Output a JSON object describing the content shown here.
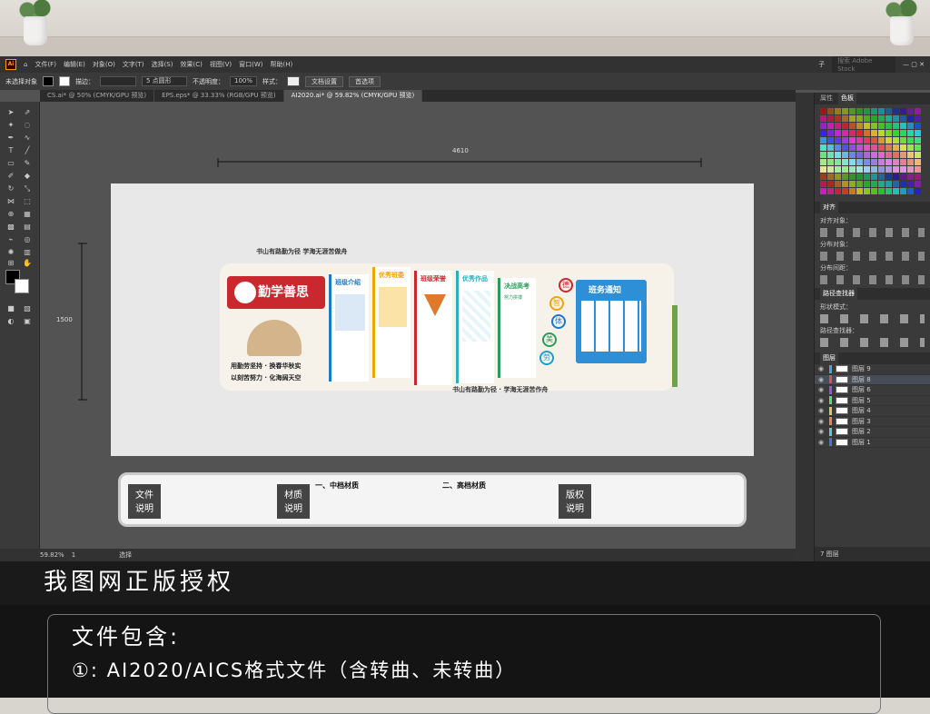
{
  "app": {
    "logo": "Ai",
    "menus": [
      "文件(F)",
      "编辑(E)",
      "对象(O)",
      "文字(T)",
      "选择(S)",
      "效果(C)",
      "视图(V)",
      "窗口(W)",
      "帮助(H)"
    ],
    "search_placeholder": "搜索 Adobe Stock",
    "user": "子"
  },
  "control": {
    "selection": "未选择对象",
    "stroke_label": "描边：",
    "point_type": "5 点圆形",
    "opacity_label": "不透明度：",
    "opacity": "100%",
    "style_label": "样式：",
    "doc_setup": "文档设置",
    "prefs": "首选项"
  },
  "tabs": [
    "CS.ai* @ 50% (CMYK/GPU 预览)",
    "EPS.eps* @ 33.33% (RGB/GPU 预览)",
    "AI2020.ai* @ 59.82% (CMYK/GPU 预览)"
  ],
  "canvas": {
    "width_dim": "4610",
    "height_dim": "1500"
  },
  "design": {
    "slogan_top": "书山有路勤为径 学海无涯苦做舟",
    "logo_title": "勤学善思",
    "poem_line1": "用勤劳坚持 · 换春华秋实",
    "poem_line2": "以刻苦努力 · 化海阔天空",
    "sections": [
      "班级介绍",
      "优秀班委",
      "班级荣誉",
      "优秀作品",
      "决战高考"
    ],
    "virtues": [
      "德",
      "智",
      "体",
      "美",
      "劳"
    ],
    "notice": "班务通知",
    "slogan_bottom": "书山有路勤为径 · 学海无涯苦作舟",
    "sub_label": "努力拼搏"
  },
  "legend": {
    "file_note": [
      "文件",
      "说明"
    ],
    "material_note": [
      "材质",
      "说明"
    ],
    "copyright_note": [
      "版权",
      "说明"
    ],
    "mid_material": "一、中档材质",
    "high_material": "二、高档材质"
  },
  "status": {
    "zoom": "59.82%",
    "page": "1",
    "mode": "选择"
  },
  "panel": {
    "tabs": [
      "属性",
      "色板"
    ],
    "align_tab": "对齐",
    "align_objects": "对齐对象：",
    "distribute_objects": "分布对象：",
    "distribute_spacing": "分布间距：",
    "pathfinder": "路径查找器",
    "shape_modes": "形状模式：",
    "pathfinders": "路径查找器：",
    "layers_tab": "图层",
    "layers": [
      "图层 9",
      "图层 8",
      "图层 6",
      "图层 5",
      "图层 4",
      "图层 3",
      "图层 2",
      "图层 1"
    ],
    "layer_count": "7 图层"
  },
  "footer": {
    "title": "我图网正版授权",
    "contains": "文件包含:",
    "item1": "①: AI2020/AICS格式文件（含转曲、未转曲）"
  },
  "colors": {
    "accent_red": "#c8282e",
    "accent_blue": "#1e78c8",
    "accent_yellow": "#f0a500",
    "accent_teal": "#2ab0c0",
    "accent_orange": "#f07c00"
  }
}
